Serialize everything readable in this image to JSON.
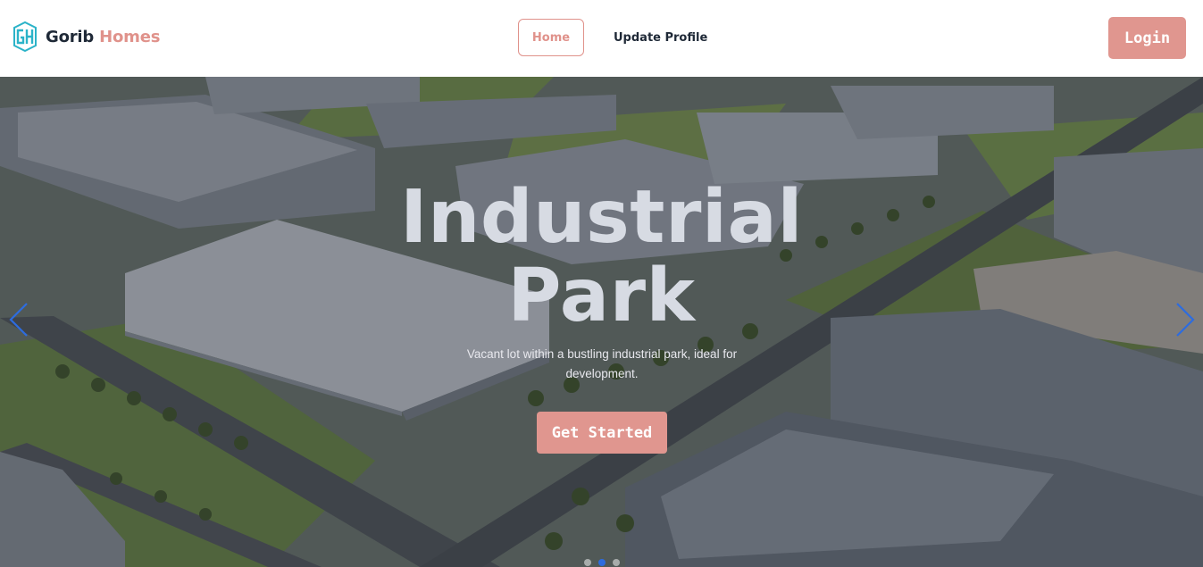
{
  "brand": {
    "logo_icon": "gh-monogram-logo",
    "name_part1": "Gorib",
    "name_part2": "Homes",
    "accent_color": "#e0928b",
    "logo_color": "#2bb3c8"
  },
  "nav": {
    "items": [
      {
        "label": "Home",
        "active": true
      },
      {
        "label": "Update Profile",
        "active": false
      }
    ],
    "login_label": "Login"
  },
  "hero": {
    "title_line1": "Industrial",
    "title_line2": "Park",
    "subtitle": "Vacant lot within a bustling industrial park, ideal for development.",
    "cta_label": "Get Started",
    "prev_icon": "chevron-left-icon",
    "next_icon": "chevron-right-icon",
    "arrow_color": "#2d6cdf",
    "slides_count": 3,
    "active_slide": 1
  }
}
